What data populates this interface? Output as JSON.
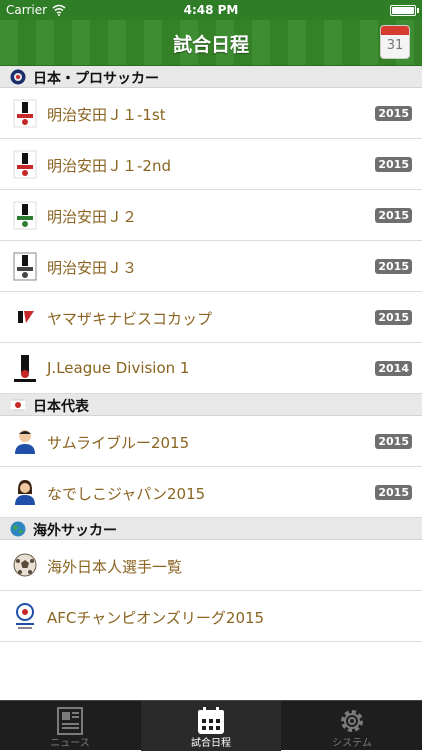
{
  "status": {
    "carrier": "Carrier",
    "time": "4:48 PM"
  },
  "header": {
    "title": "試合日程",
    "calendar_day": "31"
  },
  "sections": [
    {
      "label": "日本・プロサッカー",
      "items": [
        {
          "label": "明治安田Ｊ１-1st",
          "year": "2015"
        },
        {
          "label": "明治安田Ｊ１-2nd",
          "year": "2015"
        },
        {
          "label": "明治安田Ｊ２",
          "year": "2015"
        },
        {
          "label": "明治安田Ｊ３",
          "year": "2015"
        },
        {
          "label": "ヤマザキナビスコカップ",
          "year": "2015"
        },
        {
          "label": "J.League Division 1",
          "year": "2014"
        }
      ]
    },
    {
      "label": "日本代表",
      "items": [
        {
          "label": "サムライブルー2015",
          "year": "2015"
        },
        {
          "label": "なでしこジャパン2015",
          "year": "2015"
        }
      ]
    },
    {
      "label": "海外サッカー",
      "items": [
        {
          "label": "海外日本人選手一覧"
        },
        {
          "label": "AFCチャンピオンズリーグ2015"
        }
      ]
    }
  ],
  "tabs": [
    {
      "label": "ニュース",
      "icon": "newspaper-icon"
    },
    {
      "label": "試合日程",
      "icon": "calendar-icon"
    },
    {
      "label": "システム",
      "icon": "gear-icon"
    }
  ],
  "colors": {
    "accent_text": "#8a6420",
    "header_green": "#3f8d33",
    "badge": "#6f6f6f"
  }
}
